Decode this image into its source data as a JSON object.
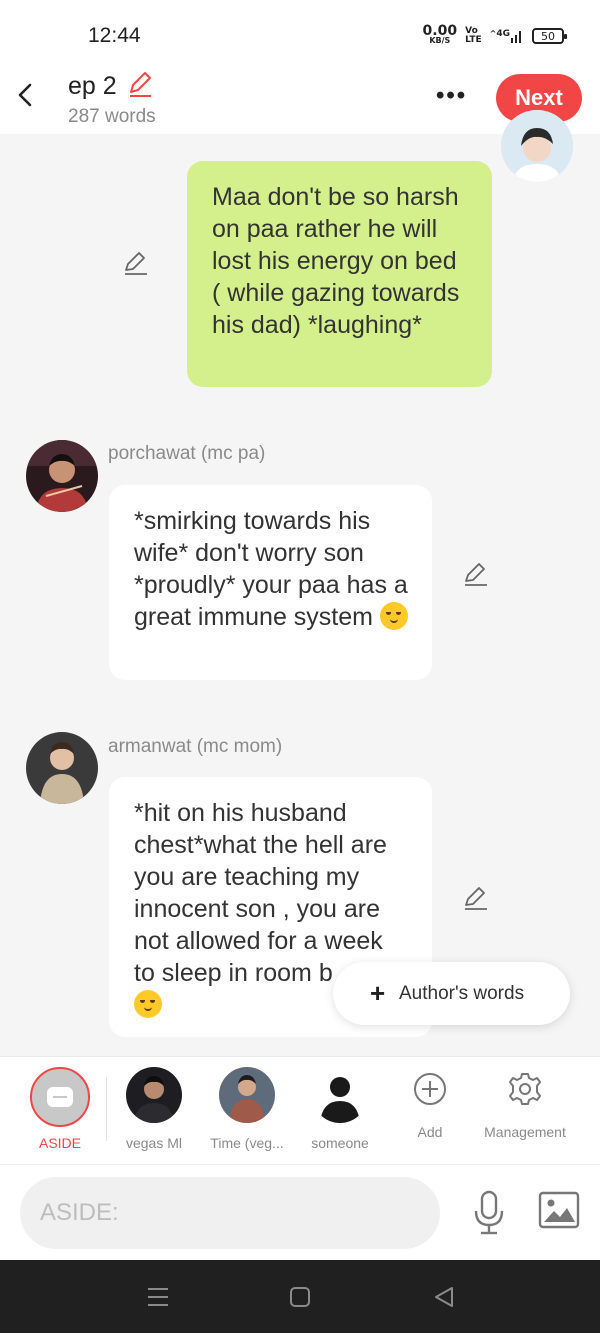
{
  "status_bar": {
    "time": "12:44",
    "net_speed_value": "0.00",
    "net_speed_unit": "KB/S",
    "volte_top": "Vo",
    "volte_bottom": "LTE",
    "network": "4G",
    "battery": "50"
  },
  "header": {
    "title": "ep 2",
    "word_count": "287 words",
    "more_label": "•••",
    "next_label": "Next"
  },
  "messages": [
    {
      "id": "self",
      "text": "Maa don't be so harsh on paa rather he will lost his energy on bed ( while gazing towards his dad) *laughing*"
    },
    {
      "id": "porchawat",
      "speaker": "porchawat (mc pa)",
      "text": "*smirking towards his wife* don't worry son *proudly* your paa has a great immune system"
    },
    {
      "id": "armanwat",
      "speaker": "armanwat (mc mom)",
      "text": "*hit on his husband chest*what the hell are you are teaching my innocent son , you are not allowed for a week to sleep in room b"
    }
  ],
  "authors_words": {
    "label": "Author's words"
  },
  "characters": [
    {
      "name": "ASIDE",
      "selected": true
    },
    {
      "name": "vegas Ml"
    },
    {
      "name": "Time (veg..."
    },
    {
      "name": "someone"
    },
    {
      "name": "Add"
    },
    {
      "name": "Management"
    }
  ],
  "composer": {
    "placeholder": "ASIDE:"
  },
  "colors": {
    "accent": "#f24646",
    "self_bubble": "#d4f08c",
    "background": "#f5f5f5"
  }
}
